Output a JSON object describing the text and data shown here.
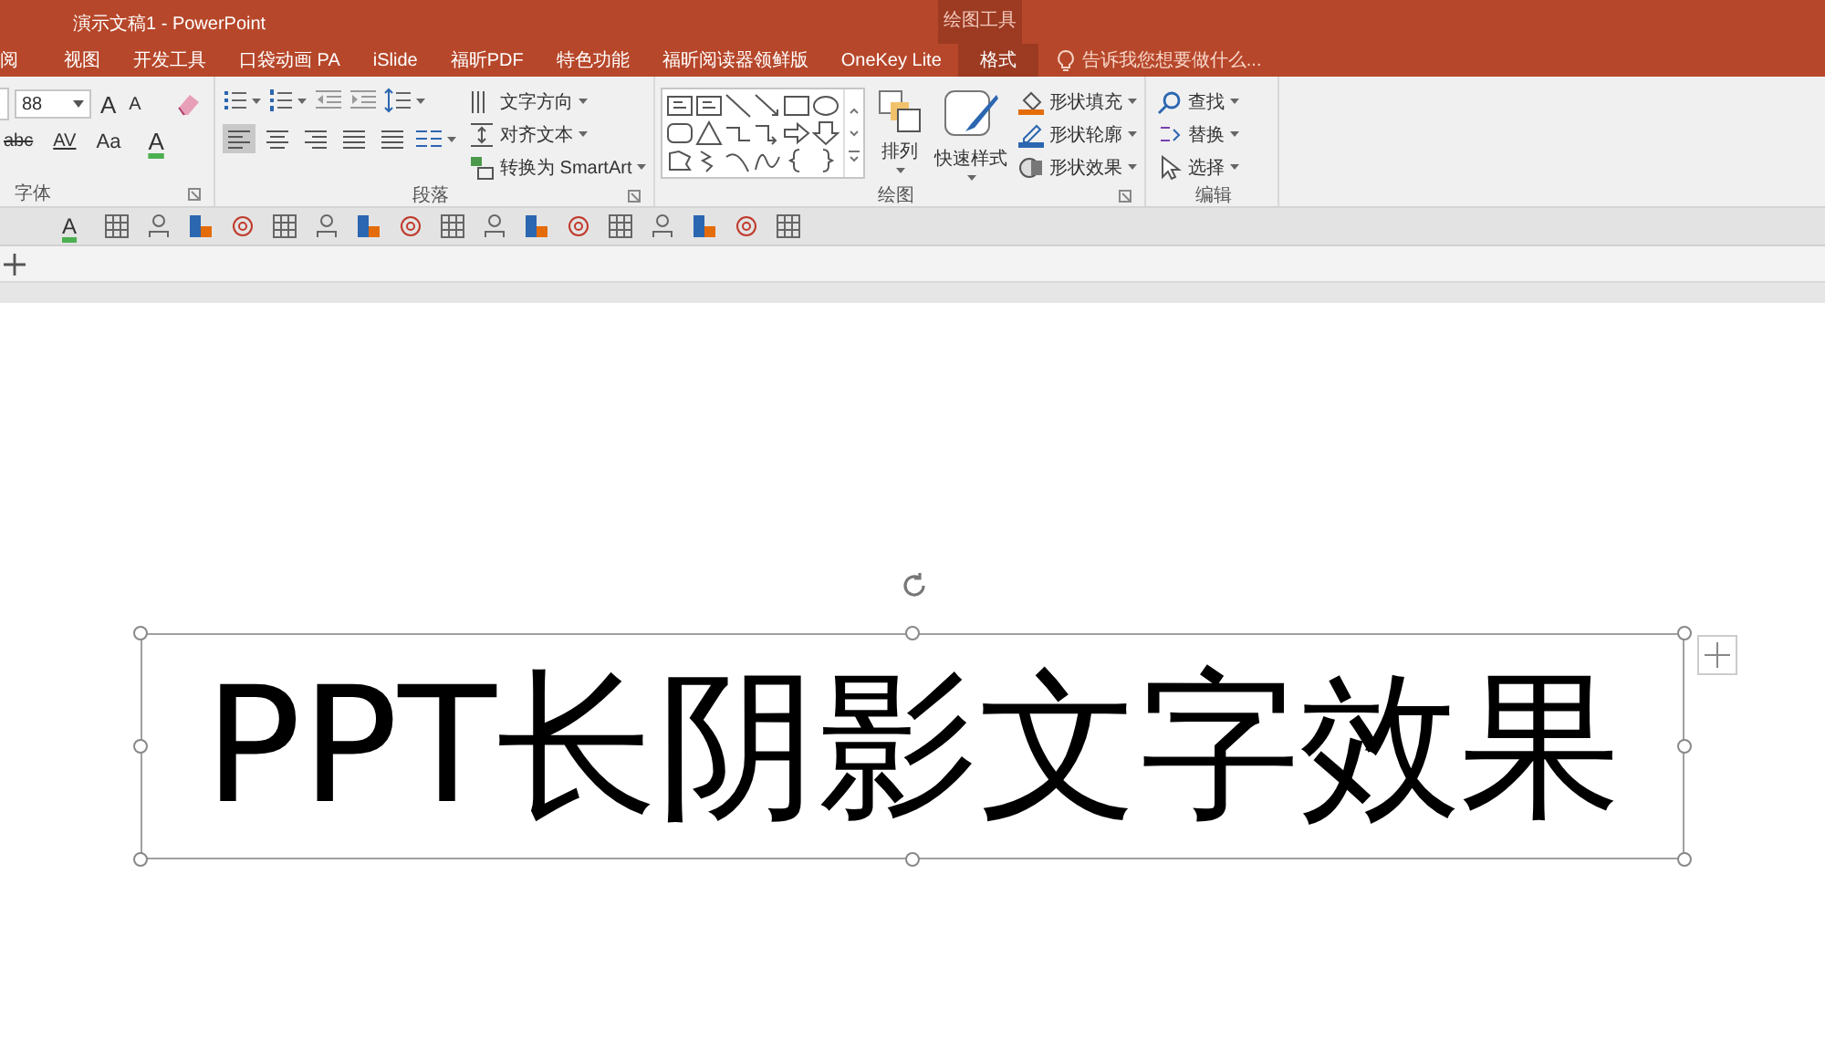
{
  "title_bar": {
    "title": "演示文稿1 - PowerPoint",
    "context_label": "绘图工具"
  },
  "tabs": [
    {
      "label": "阅",
      "selected": false
    },
    {
      "label": "视图",
      "selected": false
    },
    {
      "label": "开发工具",
      "selected": false
    },
    {
      "label": "口袋动画 PA",
      "selected": false
    },
    {
      "label": "iSlide",
      "selected": false
    },
    {
      "label": "福昕PDF",
      "selected": false
    },
    {
      "label": "特色功能",
      "selected": false
    },
    {
      "label": "福昕阅读器领鲜版",
      "selected": false
    },
    {
      "label": "OneKey Lite",
      "selected": false
    },
    {
      "label": "格式",
      "selected": true
    }
  ],
  "tell_me": {
    "placeholder": "告诉我您想要做什么..."
  },
  "ribbon": {
    "font": {
      "label": "字体",
      "size": "88",
      "buttons": [
        {
          "kind": "grow",
          "text": "A"
        },
        {
          "kind": "shrink",
          "text": "A"
        },
        {
          "kind": "strike",
          "text": "abc"
        },
        {
          "kind": "spacing",
          "text": "AV"
        },
        {
          "kind": "case",
          "text": "Aa"
        },
        {
          "kind": "color",
          "text": "A"
        }
      ]
    },
    "paragraph": {
      "label": "段落",
      "alignments": [
        {
          "selected": true
        },
        {
          "selected": false
        },
        {
          "selected": false
        },
        {
          "selected": false
        },
        {
          "selected": false
        }
      ],
      "commands": [
        "文字方向",
        "对齐文本",
        "转换为 SmartArt"
      ]
    },
    "drawing": {
      "label": "绘图",
      "arrange": "排列",
      "quick_styles": "快速样式",
      "shape_commands": [
        "形状填充",
        "形状轮廓",
        "形状效果"
      ]
    },
    "editing": {
      "label": "编辑",
      "commands": [
        "查找",
        "替换",
        "选择"
      ]
    }
  },
  "quick_toolbar": {
    "font_color": "A"
  },
  "slide": {
    "text": "PPT长阴影文字效果"
  }
}
